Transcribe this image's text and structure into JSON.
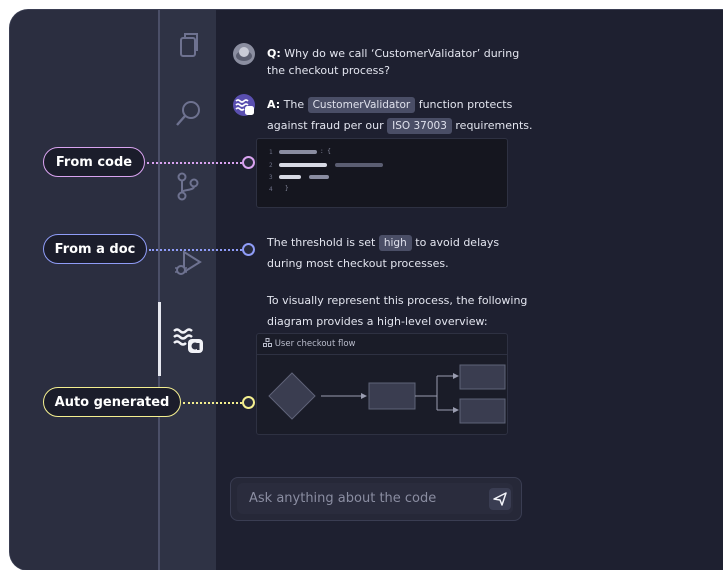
{
  "chat": {
    "question_prefix": "Q:",
    "question_line1": "Why do we call ‘CustomerValidator’ during",
    "question_line2": "the checkout process?",
    "answer_prefix": "A:",
    "answer_the": "The",
    "answer_tag_function": "CustomerValidator",
    "answer_mid": "function protects",
    "answer_line2_pre": "against fraud per our",
    "answer_tag_iso": "ISO 37003",
    "answer_line2_post": "requirements.",
    "threshold_pre": "The threshold is set",
    "threshold_tag": "high",
    "threshold_post": "to avoid delays",
    "threshold_line2": "during most checkout processes.",
    "visual_line1": "To visually represent this process, the following",
    "visual_line2": "diagram provides a high-level overview:"
  },
  "code": {
    "line_numbers": [
      "1",
      "2",
      "3",
      "4"
    ],
    "line1_suffix": ": {",
    "line4_text": "}"
  },
  "diagram": {
    "title": "User checkout flow"
  },
  "input": {
    "placeholder": "Ask anything about the code"
  },
  "callouts": {
    "from_code": "From code",
    "from_doc": "From a doc",
    "auto_generated": "Auto generated"
  },
  "colors": {
    "from_code": "#d9a3f0",
    "from_doc": "#8f9cf7",
    "auto_generated": "#f4ef8f"
  },
  "icons": [
    "files-icon",
    "search-icon",
    "source-control-icon",
    "run-debug-icon",
    "assistant-icon"
  ]
}
